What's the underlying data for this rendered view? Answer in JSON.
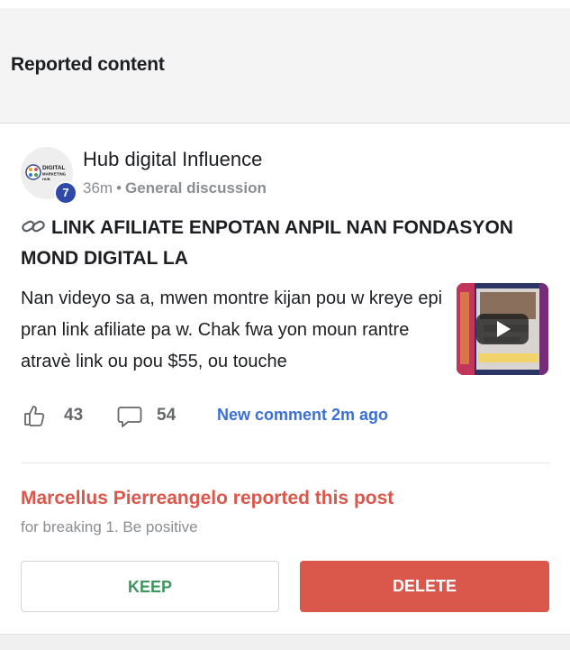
{
  "header": {
    "title": "Reported content"
  },
  "post": {
    "group_name": "Hub digital Influence",
    "avatar_badge": "7",
    "avatar_logo_lines": [
      "DIGITAL",
      "MARKETING",
      "HUB"
    ],
    "time": "36m",
    "category": "General discussion",
    "title": "LINK AFILIATE ENPOTAN ANPIL NAN FONDASYON MOND DIGITAL LA",
    "body": "Nan videyo sa a, mwen montre kijan pou w kreye epi pran link afiliate pa w. Chak fwa yon moun rantre atravè link ou pou $55, ou touche",
    "likes": "43",
    "comments": "54",
    "new_comment": "New comment 2m ago"
  },
  "report": {
    "line": "Marcellus Pierreangelo reported this post",
    "reason": "for breaking 1. Be positive"
  },
  "actions": {
    "keep_label": "KEEP",
    "delete_label": "DELETE"
  },
  "colors": {
    "accent_red": "#d9574b",
    "keep_green": "#3f9660",
    "link_blue": "#3a6fd8",
    "badge_blue": "#2e4aa8"
  },
  "icons": [
    "link-icon",
    "like-icon",
    "comment-icon",
    "play-icon"
  ]
}
